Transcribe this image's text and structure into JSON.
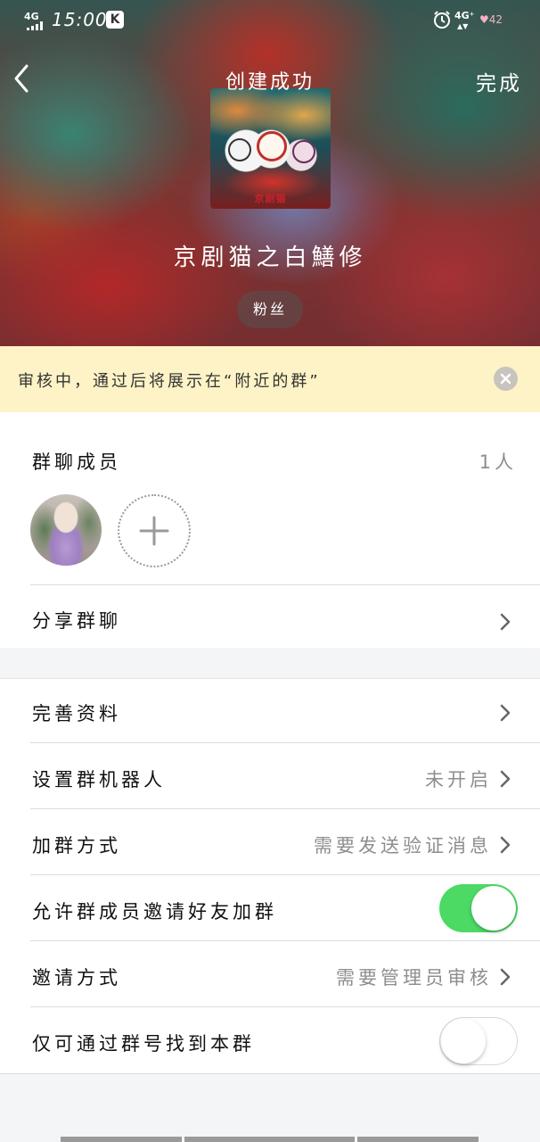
{
  "status_bar": {
    "signal": "4G",
    "time": "15:00",
    "app_badge": "K",
    "network": "4G⁺",
    "battery": "♥42"
  },
  "header": {
    "title": "创建成功",
    "done_label": "完成"
  },
  "group": {
    "cover_text": "京剧猫",
    "name": "京剧猫之白鱔修",
    "tag": "粉丝"
  },
  "notice": {
    "text": "审核中，通过后将展示在“附近的群”"
  },
  "members": {
    "label": "群聊成员",
    "count": "1人"
  },
  "share": {
    "label": "分享群聊"
  },
  "settings": [
    {
      "label": "完善资料",
      "value": ""
    },
    {
      "label": "设置群机器人",
      "value": "未开启"
    },
    {
      "label": "加群方式",
      "value": "需要发送验证消息"
    },
    {
      "label": "允许群成员邀请好友加群",
      "toggle": true
    },
    {
      "label": "邀请方式",
      "value": "需要管理员审核"
    },
    {
      "label": "仅可通过群号找到本群",
      "toggle": false
    }
  ],
  "colors": {
    "toggle_on": "#4cd964",
    "notice_bg": "#fdf3c6",
    "secondary_text": "#8e8e8e"
  }
}
